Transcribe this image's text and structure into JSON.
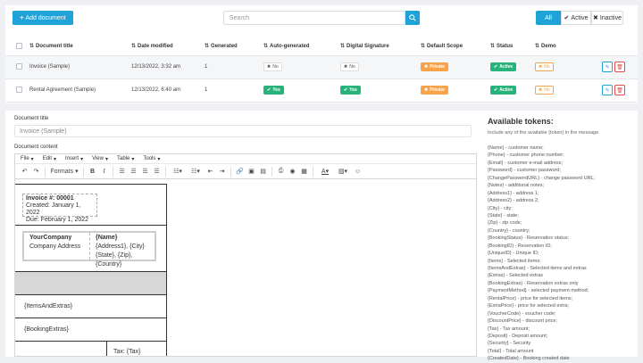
{
  "header": {
    "add_label": "Add document",
    "search_placeholder": "Search",
    "filters": {
      "all": "All",
      "active": "Active",
      "inactive": "Inactive"
    }
  },
  "table": {
    "columns": [
      "Document title",
      "Date modified",
      "Generated",
      "Auto-generated",
      "Digital Signature",
      "Default Scope",
      "Status",
      "Demo"
    ],
    "rows": [
      {
        "title": "Invoice (Sample)",
        "date": "12/13/2022, 3:32 am",
        "generated": "1",
        "auto": "No",
        "signature": "No",
        "scope": "Private",
        "status": "Active",
        "demo": "No"
      },
      {
        "title": "Rental Agreement (Sample)",
        "date": "12/13/2022, 6:40 am",
        "generated": "1",
        "auto": "Yes",
        "signature": "Yes",
        "scope": "Private",
        "status": "Active",
        "demo": "No"
      }
    ]
  },
  "editor": {
    "title_label": "Document title",
    "title_value": "Invoice (Sample)",
    "content_label": "Document content",
    "menu": [
      "File",
      "Edit",
      "Insert",
      "View",
      "Table",
      "Tools"
    ],
    "formats_label": "Formats",
    "invoice_no": "Invoice #: 00001",
    "created": "Created: January 1, 2022",
    "due": "Due: February 1, 2022",
    "company": "YourCompany",
    "company_addr": "Company Address",
    "cust_name": "{Name}",
    "cust_addr1": "{Address1}, {City}",
    "cust_addr2": "{State}, {Zip},",
    "cust_country": "{Country}",
    "items": "{ItemsAndExtras}",
    "booking_extras": "{BookingExtras}",
    "tax": "Tax: {Tax}"
  },
  "tokens": {
    "title": "Available tokens:",
    "hint": "Include any of the available {token} in the message.",
    "list": [
      "{Name} - customer name;",
      "{Phone} - customer phone number;",
      "{Email} - customer e-mail address;",
      "{Password} - customer password;",
      "{ChangePasswordURL} - change password URL;",
      "{Notes} - additional notes;",
      "{Address1} - address 1;",
      "{Address2} - address 2;",
      "{City} - city;",
      "{State} - state;",
      "{Zip} - zip code;",
      "{Country} - country;",
      "{BookingStatus} - Reservation status;",
      "{BookingID} - Reservation ID;",
      "{UniqueID} - Unique ID;",
      "{Items} - Selected items;",
      "{ItemsAndExtras} - Selected items and extras",
      "{Extras} - Selected extras",
      "{BookingExtras} - Reservation extras only",
      "{PaymentMethod} - selected payment method;",
      "{RentalPrice} - price for selected items;",
      "{ExtraPrice} - price for selected extra;",
      "{VoucherCode} - voucher code;",
      "{DiscountPrice} - discount price;",
      "{Tax} - Tax amount;",
      "{Deposit} - Deposit amount;",
      "{Security} - Security",
      "{Total} - Total amount",
      "{CreatedDate} - Booking created date"
    ]
  }
}
